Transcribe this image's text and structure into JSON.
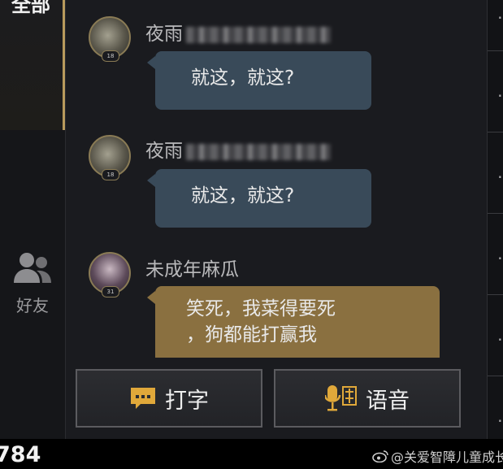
{
  "nav": {
    "all_label": "全部",
    "friends_label": "好友"
  },
  "messages": [
    {
      "name": "夜雨",
      "level": "18",
      "text": "就这，就这?"
    },
    {
      "name": "夜雨",
      "level": "18",
      "text": "就这，就这?"
    },
    {
      "name": "未成年麻瓜",
      "level": "31",
      "line1": "笑死，我菜得要死",
      "line2": "，狗都能打赢我"
    }
  ],
  "buttons": {
    "type_label": "打字",
    "voice_label": "语音"
  },
  "bottom": {
    "number": "784",
    "watermark": "@关爱智障儿童成长"
  },
  "colors": {
    "accent_gold": "#b89a5c",
    "bubble_blue": "#394a59",
    "bubble_gold": "#8a7040"
  }
}
